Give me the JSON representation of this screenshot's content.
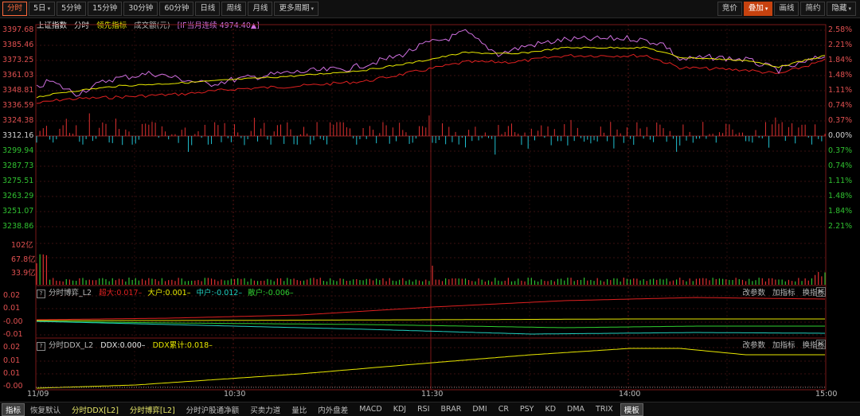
{
  "toolbar": {
    "left": [
      {
        "label": "分时",
        "active": true,
        "arrow": false
      },
      {
        "label": "5日",
        "active": false,
        "arrow": true
      },
      {
        "label": "5分钟",
        "active": false,
        "arrow": false
      },
      {
        "label": "15分钟",
        "active": false,
        "arrow": false
      },
      {
        "label": "30分钟",
        "active": false,
        "arrow": false
      },
      {
        "label": "60分钟",
        "active": false,
        "arrow": false
      },
      {
        "label": "日线",
        "active": false,
        "arrow": false
      },
      {
        "label": "周线",
        "active": false,
        "arrow": false
      },
      {
        "label": "月线",
        "active": false,
        "arrow": false
      },
      {
        "label": "更多周期",
        "active": false,
        "arrow": true
      }
    ],
    "right": [
      {
        "label": "竞价",
        "style": "normal",
        "arrow": false
      },
      {
        "label": "叠加",
        "style": "orange",
        "arrow": true
      },
      {
        "label": "画线",
        "style": "normal",
        "arrow": false
      },
      {
        "label": "简约",
        "style": "normal",
        "arrow": false
      },
      {
        "label": "隐藏",
        "style": "normal",
        "arrow": true
      }
    ]
  },
  "main_legend": {
    "index_name": "上证指数",
    "intraday": "分时",
    "leading": "领先指标",
    "volume": "成交额(元)",
    "overlay": "[IF当月连续 4974.40▲]"
  },
  "price_axis": [
    "3397.68",
    "3385.46",
    "3373.25",
    "3361.03",
    "3348.81",
    "3336.59",
    "3324.38",
    "3312.16",
    "3299.94",
    "3287.73",
    "3275.51",
    "3263.29",
    "3251.07",
    "3238.86"
  ],
  "pct_axis": [
    "2.58%",
    "2.21%",
    "1.84%",
    "1.48%",
    "1.11%",
    "0.74%",
    "0.37%",
    "0.00%",
    "0.37%",
    "0.74%",
    "1.11%",
    "1.48%",
    "1.84%",
    "2.21%"
  ],
  "volume_axis": [
    "102亿",
    "67.8亿",
    "33.9亿"
  ],
  "ind1": {
    "name": "分时博弈_L2",
    "super_label": "超大:0.017–",
    "big_label": "大户:0.001–",
    "mid_label": "中户:-0.012–",
    "small_label": "散户:-0.006–",
    "axis": [
      "0.02",
      "0.01",
      "-0.00",
      "-0.01"
    ],
    "tools": [
      "改参数",
      "加指标",
      "换指标"
    ]
  },
  "ind2": {
    "name": "分时DDX_L2",
    "ddx_label": "DDX:0.000–",
    "ddx_cum_label": "DDX累计:0.018–",
    "axis": [
      "0.02",
      "0.01",
      "0.01",
      "-0.00"
    ],
    "tools": [
      "改参数",
      "加指标",
      "换指标"
    ]
  },
  "time_axis": [
    "11/09",
    "10:30",
    "11:30",
    "14:00",
    "15:00"
  ],
  "bottom_tabs": [
    {
      "label": "指标",
      "sel": true
    },
    {
      "label": "恢复默认",
      "sel": false
    },
    {
      "label": "分时DDX[L2]",
      "sel": false,
      "yel": true
    },
    {
      "label": "分时博弈[L2]",
      "sel": false,
      "yel": true
    },
    {
      "label": "分时沪股通净额",
      "sel": false
    },
    {
      "label": "买卖力道",
      "sel": false
    },
    {
      "label": "量比",
      "sel": false
    },
    {
      "label": "内外盘差",
      "sel": false
    },
    {
      "label": "MACD",
      "sel": false
    },
    {
      "label": "KDJ",
      "sel": false
    },
    {
      "label": "RSI",
      "sel": false
    },
    {
      "label": "BRAR",
      "sel": false
    },
    {
      "label": "DMI",
      "sel": false
    },
    {
      "label": "CR",
      "sel": false
    },
    {
      "label": "PSY",
      "sel": false
    },
    {
      "label": "KD",
      "sel": false
    },
    {
      "label": "DMA",
      "sel": false
    },
    {
      "label": "TRIX",
      "sel": false
    },
    {
      "label": "模板",
      "sel": true
    }
  ],
  "colors": {
    "up": "#e03030",
    "down": "#20c0d0",
    "price": "#ffffff",
    "avg": "#e8e800",
    "overlay": "#d070e0",
    "super": "#e02020",
    "big": "#e8e800",
    "mid": "#20d0c0",
    "small": "#30d030"
  }
}
